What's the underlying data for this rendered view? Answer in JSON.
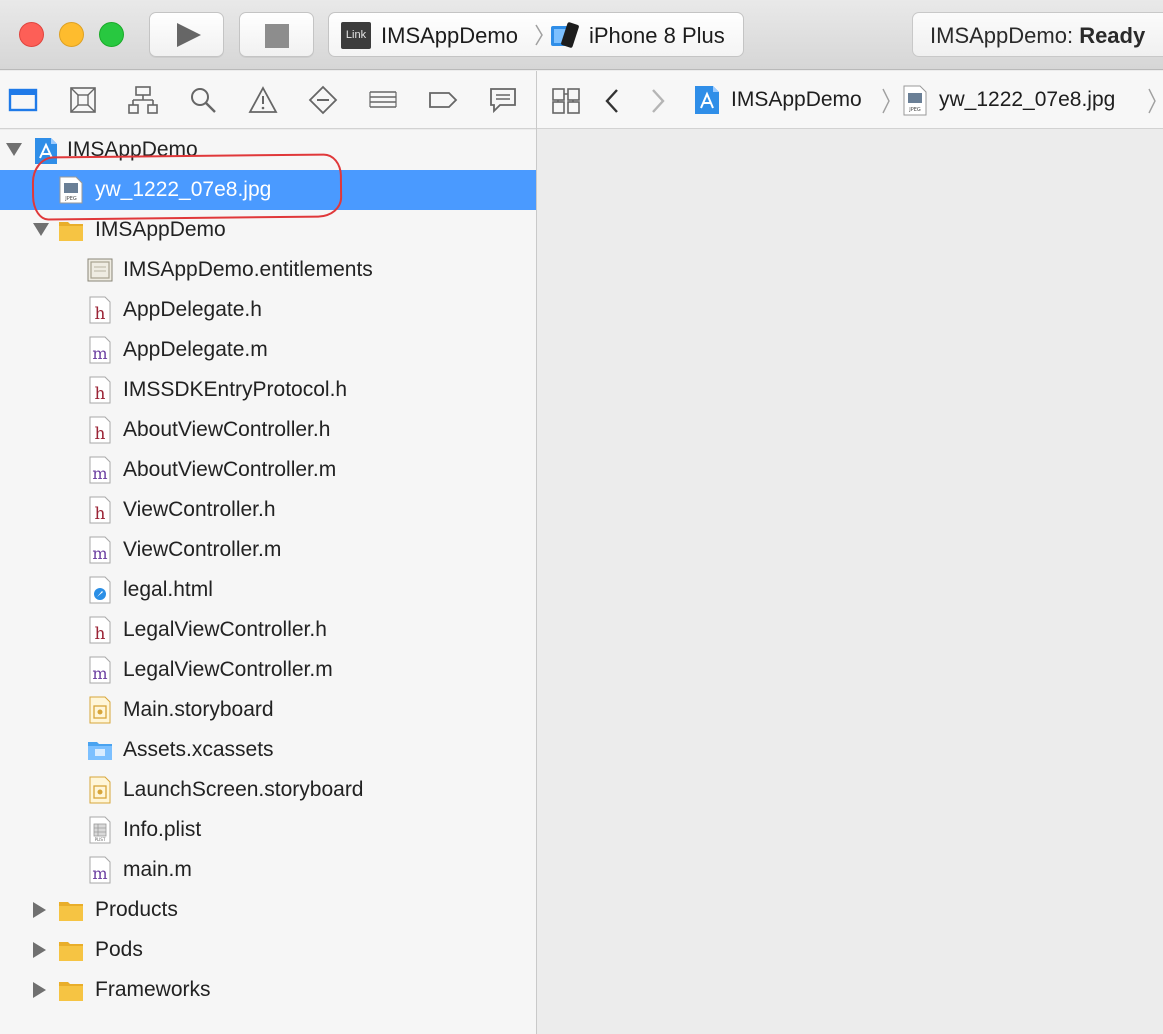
{
  "toolbar": {
    "scheme_badge": "Link",
    "scheme_name": "IMSAppDemo",
    "device_name": "iPhone 8 Plus",
    "status_app": "IMSAppDemo:",
    "status_state": "Ready"
  },
  "navigator_tabs": [
    {
      "name": "project-navigator-icon"
    },
    {
      "name": "source-control-icon"
    },
    {
      "name": "symbol-navigator-icon"
    },
    {
      "name": "find-navigator-icon"
    },
    {
      "name": "issue-navigator-icon"
    },
    {
      "name": "test-navigator-icon"
    },
    {
      "name": "debug-navigator-icon"
    },
    {
      "name": "breakpoint-navigator-icon"
    },
    {
      "name": "report-navigator-icon"
    }
  ],
  "jumpbar": {
    "project": "IMSAppDemo",
    "file": "yw_1222_07e8.jpg"
  },
  "tree": [
    {
      "label": "IMSAppDemo",
      "icon": "xcode-project-icon",
      "level": 0,
      "disclosure": "open"
    },
    {
      "label": "yw_1222_07e8.jpg",
      "icon": "jpeg-file-icon",
      "level": 1,
      "selected": true
    },
    {
      "label": "IMSAppDemo",
      "icon": "folder-icon",
      "level": 1,
      "disclosure": "open"
    },
    {
      "label": "IMSAppDemo.entitlements",
      "icon": "entitlements-file-icon",
      "level": 2
    },
    {
      "label": "AppDelegate.h",
      "icon": "header-file-icon",
      "level": 2
    },
    {
      "label": "AppDelegate.m",
      "icon": "objc-file-icon",
      "level": 2
    },
    {
      "label": "IMSSDKEntryProtocol.h",
      "icon": "header-file-icon",
      "level": 2
    },
    {
      "label": "AboutViewController.h",
      "icon": "header-file-icon",
      "level": 2
    },
    {
      "label": "AboutViewController.m",
      "icon": "objc-file-icon",
      "level": 2
    },
    {
      "label": "ViewController.h",
      "icon": "header-file-icon",
      "level": 2
    },
    {
      "label": "ViewController.m",
      "icon": "objc-file-icon",
      "level": 2
    },
    {
      "label": "legal.html",
      "icon": "html-file-icon",
      "level": 2
    },
    {
      "label": "LegalViewController.h",
      "icon": "header-file-icon",
      "level": 2
    },
    {
      "label": "LegalViewController.m",
      "icon": "objc-file-icon",
      "level": 2
    },
    {
      "label": "Main.storyboard",
      "icon": "storyboard-file-icon",
      "level": 2
    },
    {
      "label": "Assets.xcassets",
      "icon": "asset-catalog-icon",
      "level": 2
    },
    {
      "label": "LaunchScreen.storyboard",
      "icon": "storyboard-file-icon",
      "level": 2
    },
    {
      "label": "Info.plist",
      "icon": "plist-file-icon",
      "level": 2
    },
    {
      "label": "main.m",
      "icon": "objc-file-icon",
      "level": 2
    },
    {
      "label": "Products",
      "icon": "folder-icon",
      "level": 1,
      "disclosure": "closed"
    },
    {
      "label": "Pods",
      "icon": "folder-icon",
      "level": 1,
      "disclosure": "closed"
    },
    {
      "label": "Frameworks",
      "icon": "folder-icon",
      "level": 1,
      "disclosure": "closed"
    }
  ],
  "colors": {
    "selection": "#4a9aff",
    "annotation_ring": "#e0383a",
    "folder": "#f6c443",
    "header_letter": "#9b2335",
    "impl_letter": "#6b3fa0"
  }
}
